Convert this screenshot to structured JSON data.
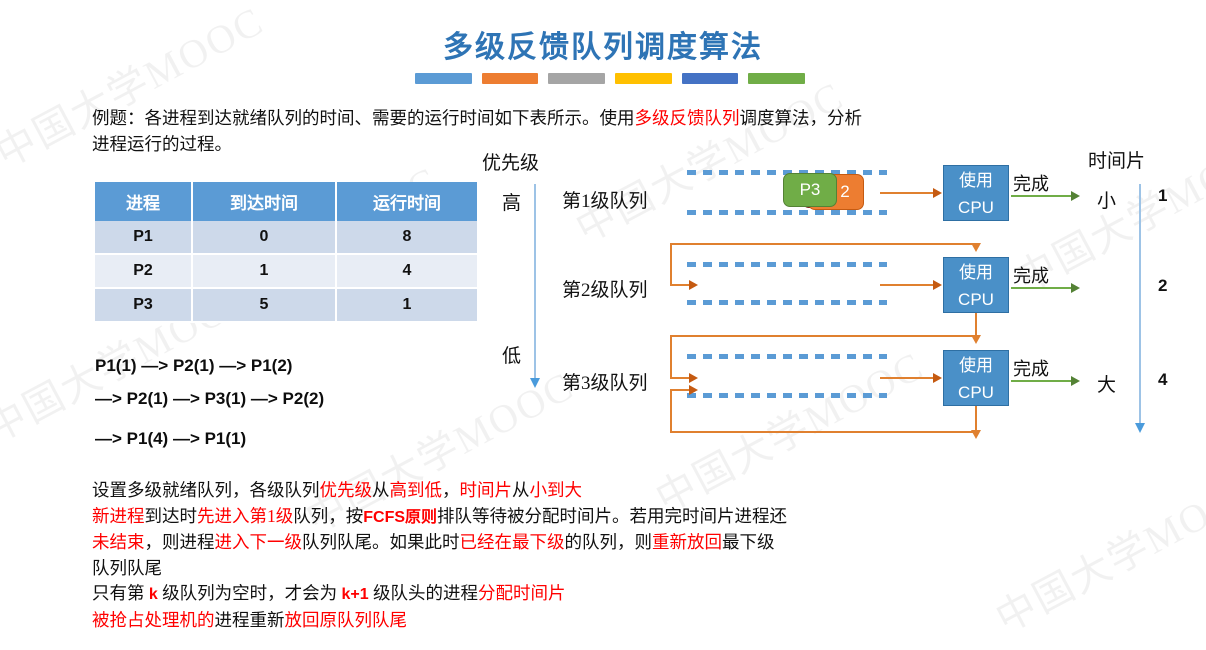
{
  "title": "多级反馈队列调度算法",
  "rule_colors": [
    "#5B9BD5",
    "#ED7D31",
    "#A5A5A5",
    "#FFC000",
    "#4472C4",
    "#70AD47"
  ],
  "intro": {
    "part1": "例题：各进程到达就绪队列的时间、需要的运行时间如下表所示。使用",
    "highlight": "多级反馈队列",
    "part2": "调度算法，分析",
    "line2": "进程运行的过程。"
  },
  "table": {
    "headers": [
      "进程",
      "到达时间",
      "运行时间"
    ],
    "rows": [
      [
        "P1",
        "0",
        "8"
      ],
      [
        "P2",
        "1",
        "4"
      ],
      [
        "P3",
        "5",
        "1"
      ]
    ]
  },
  "sequence": [
    "P1(1) —> P2(1) —> P1(2)",
    "—> P2(1) —> P3(1) —> P2(2)",
    "—> P1(4) —> P1(1)"
  ],
  "diagram": {
    "priority_label": "优先级",
    "priority_high": "高",
    "priority_low": "低",
    "timeslice_label": "时间片",
    "timeslice_small": "小",
    "timeslice_large": "大",
    "queues": [
      {
        "name": "第1级队列",
        "cpu_line1": "使用",
        "cpu_line2": "CPU",
        "done": "完成",
        "slice": "1"
      },
      {
        "name": "第2级队列",
        "cpu_line1": "使用",
        "cpu_line2": "CPU",
        "done": "完成",
        "slice": "2"
      },
      {
        "name": "第3级队列",
        "cpu_line1": "使用",
        "cpu_line2": "CPU",
        "done": "完成",
        "slice": "4"
      }
    ],
    "queue1_processes": [
      {
        "label": "P3",
        "color": "green"
      },
      {
        "label": "2",
        "color": "orange"
      }
    ]
  },
  "explanation": {
    "l1a": "设置多级就绪队列，各级队列",
    "l1b": "优先级",
    "l1c": "从",
    "l1d": "高到低",
    "l1e": "，",
    "l1f": "时间片",
    "l1g": "从",
    "l1h": "小到大",
    "l2a": "新进程",
    "l2b": "到达时",
    "l2c": "先进入第1级",
    "l2d": "队列，按",
    "l2e": "FCFS原则",
    "l2f": "排队等待被分配时间片。若用完时间片进程还",
    "l3a": "未结束",
    "l3b": "，则进程",
    "l3c": "进入下一级",
    "l3d": "队列队尾。如果此时",
    "l3e": "已经在最下级",
    "l3f": "的队列，则",
    "l3g": "重新放回",
    "l3h": "最下级",
    "l4": "队列队尾",
    "l5a": "只有第 ",
    "l5b": "k",
    "l5c": " 级队列为空时，才会为 ",
    "l5d": "k+1",
    "l5e": " 级队头的进程",
    "l5f": "分配时间片",
    "l6a": "被抢占处理机的",
    "l6b": "进程重新",
    "l6c": "放回原队列队尾"
  },
  "watermarks": [
    "中国大学MOOC",
    "中国大学MOOC",
    "中国大学MOOC",
    "中国大学MOOC",
    "中国大学MOOC",
    "中国大学MOOC",
    "中国大学MOOC",
    "中国大学MOOC"
  ],
  "colors": {
    "title": "#2E74B5",
    "accent_red": "#FF0000",
    "table_header": "#5B9BD5",
    "cpu": "#4A90C8",
    "arrow_orange": "#E0802F",
    "arrow_green": "#70AD47",
    "axis_blue": "#9DC3E6"
  }
}
